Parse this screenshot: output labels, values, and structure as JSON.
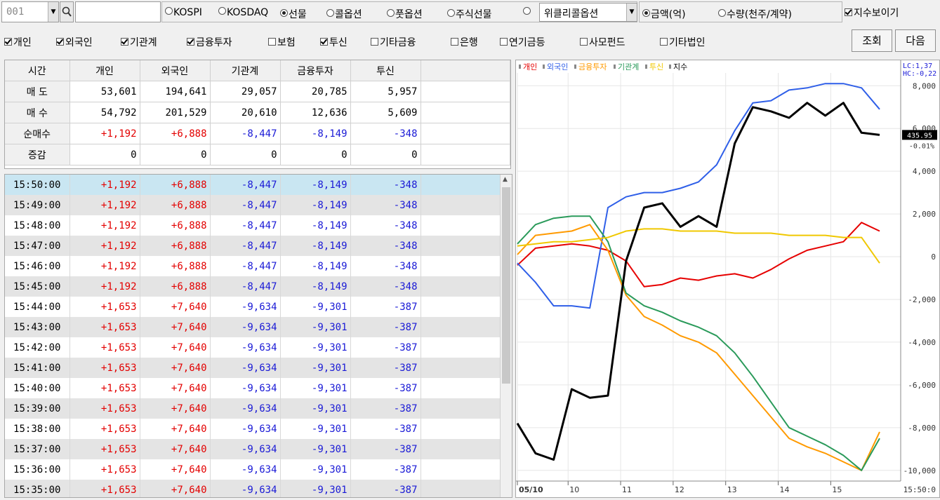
{
  "toolbar": {
    "code_value": "001",
    "market_options": [
      {
        "label": "KOSPI",
        "checked": false
      },
      {
        "label": "KOSDAQ",
        "checked": false
      },
      {
        "label": "선물",
        "checked": true
      },
      {
        "label": "콜옵션",
        "checked": false
      },
      {
        "label": "풋옵션",
        "checked": false
      },
      {
        "label": "주식선물",
        "checked": false
      },
      {
        "label": "",
        "checked": false
      }
    ],
    "weekly_select": "위클리콜옵션",
    "unit_options": [
      {
        "label": "금액(억)",
        "checked": true
      },
      {
        "label": "수량(천주/계약)",
        "checked": false
      }
    ],
    "show_index_label": "지수보이기",
    "show_index_checked": true
  },
  "investor_filters": [
    {
      "label": "개인",
      "checked": true
    },
    {
      "label": "외국인",
      "checked": true
    },
    {
      "label": "기관계",
      "checked": true
    },
    {
      "label": "금융투자",
      "checked": true
    },
    {
      "label": "보험",
      "checked": false
    },
    {
      "label": "투신",
      "checked": true
    },
    {
      "label": "기타금융",
      "checked": false
    },
    {
      "label": "은행",
      "checked": false
    },
    {
      "label": "연기금등",
      "checked": false
    },
    {
      "label": "사모펀드",
      "checked": false
    },
    {
      "label": "기타법인",
      "checked": false
    }
  ],
  "buttons": {
    "query": "조회",
    "next": "다음"
  },
  "summary": {
    "headers": [
      "시간",
      "개인",
      "외국인",
      "기관계",
      "금융투자",
      "투신"
    ],
    "rows": [
      {
        "label": "매  도",
        "values": [
          "53,601",
          "194,641",
          "29,057",
          "20,785",
          "5,957"
        ]
      },
      {
        "label": "매  수",
        "values": [
          "54,792",
          "201,529",
          "20,610",
          "12,636",
          "5,609"
        ]
      },
      {
        "label": "순매수",
        "values": [
          "+1,192",
          "+6,888",
          "-8,447",
          "-8,149",
          "-348"
        ]
      },
      {
        "label": "증감",
        "values": [
          "0",
          "0",
          "0",
          "0",
          "0"
        ]
      }
    ]
  },
  "timeline": [
    {
      "time": "15:50:00",
      "values": [
        "+1,192",
        "+6,888",
        "-8,447",
        "-8,149",
        "-348"
      ]
    },
    {
      "time": "15:49:00",
      "values": [
        "+1,192",
        "+6,888",
        "-8,447",
        "-8,149",
        "-348"
      ]
    },
    {
      "time": "15:48:00",
      "values": [
        "+1,192",
        "+6,888",
        "-8,447",
        "-8,149",
        "-348"
      ]
    },
    {
      "time": "15:47:00",
      "values": [
        "+1,192",
        "+6,888",
        "-8,447",
        "-8,149",
        "-348"
      ]
    },
    {
      "time": "15:46:00",
      "values": [
        "+1,192",
        "+6,888",
        "-8,447",
        "-8,149",
        "-348"
      ]
    },
    {
      "time": "15:45:00",
      "values": [
        "+1,192",
        "+6,888",
        "-8,447",
        "-8,149",
        "-348"
      ]
    },
    {
      "time": "15:44:00",
      "values": [
        "+1,653",
        "+7,640",
        "-9,634",
        "-9,301",
        "-387"
      ]
    },
    {
      "time": "15:43:00",
      "values": [
        "+1,653",
        "+7,640",
        "-9,634",
        "-9,301",
        "-387"
      ]
    },
    {
      "time": "15:42:00",
      "values": [
        "+1,653",
        "+7,640",
        "-9,634",
        "-9,301",
        "-387"
      ]
    },
    {
      "time": "15:41:00",
      "values": [
        "+1,653",
        "+7,640",
        "-9,634",
        "-9,301",
        "-387"
      ]
    },
    {
      "time": "15:40:00",
      "values": [
        "+1,653",
        "+7,640",
        "-9,634",
        "-9,301",
        "-387"
      ]
    },
    {
      "time": "15:39:00",
      "values": [
        "+1,653",
        "+7,640",
        "-9,634",
        "-9,301",
        "-387"
      ]
    },
    {
      "time": "15:38:00",
      "values": [
        "+1,653",
        "+7,640",
        "-9,634",
        "-9,301",
        "-387"
      ]
    },
    {
      "time": "15:37:00",
      "values": [
        "+1,653",
        "+7,640",
        "-9,634",
        "-9,301",
        "-387"
      ]
    },
    {
      "time": "15:36:00",
      "values": [
        "+1,653",
        "+7,640",
        "-9,634",
        "-9,301",
        "-387"
      ]
    },
    {
      "time": "15:35:00",
      "values": [
        "+1,653",
        "+7,640",
        "-9,634",
        "-9,301",
        "-387"
      ]
    }
  ],
  "chart_data": {
    "type": "line",
    "legend": [
      "개인",
      "외국인",
      "금융투자",
      "기관계",
      "투신",
      "지수"
    ],
    "legend_position": "top-left",
    "grid": true,
    "x_ticks": [
      "05/10",
      "10",
      "11",
      "12",
      "13",
      "14",
      "15",
      "15:50:0"
    ],
    "y_ticks": [
      "8,000",
      "6,000",
      "4,000",
      "2,000",
      "0",
      "-2,000",
      "-4,000",
      "-6,000",
      "-8,000",
      "-10,000"
    ],
    "ylim": [
      -10500,
      8600
    ],
    "top_labels": [
      "LC:1,37",
      "HC:-0,22"
    ],
    "index_last_label": "435.95",
    "index_sub_label": "-0.01%",
    "colors": {
      "개인": "#e60000",
      "외국인": "#2f5fe8",
      "금융투자": "#ff9a00",
      "기관계": "#2a9a5a",
      "투신": "#f0c800",
      "지수": "#000000"
    },
    "x": [
      0,
      0.05,
      0.1,
      0.15,
      0.2,
      0.25,
      0.3,
      0.35,
      0.4,
      0.45,
      0.5,
      0.55,
      0.6,
      0.65,
      0.7,
      0.75,
      0.8,
      0.85,
      0.9,
      0.95,
      1
    ],
    "series": [
      {
        "name": "개인",
        "values": [
          -400,
          400,
          500,
          600,
          500,
          300,
          -200,
          -1400,
          -1300,
          -1000,
          -1100,
          -900,
          -800,
          -1000,
          -600,
          -100,
          300,
          500,
          700,
          1600,
          1200
        ]
      },
      {
        "name": "외국인",
        "values": [
          -300,
          -1200,
          -2300,
          -2300,
          -2400,
          2300,
          2800,
          3000,
          3000,
          3200,
          3500,
          4300,
          5900,
          7200,
          7300,
          7800,
          7900,
          8100,
          8100,
          7900,
          6900
        ]
      },
      {
        "name": "금융투자",
        "values": [
          100,
          1000,
          1100,
          1200,
          1500,
          300,
          -1800,
          -2800,
          -3200,
          -3700,
          -4000,
          -4500,
          -5500,
          -6500,
          -7500,
          -8500,
          -8900,
          -9200,
          -9600,
          -10000,
          -8200
        ]
      },
      {
        "name": "기관계",
        "values": [
          600,
          1500,
          1800,
          1900,
          1900,
          700,
          -1700,
          -2300,
          -2600,
          -3000,
          -3300,
          -3700,
          -4500,
          -5600,
          -6800,
          -8000,
          -8400,
          -8800,
          -9300,
          -10000,
          -8500
        ]
      },
      {
        "name": "투신",
        "values": [
          500,
          600,
          700,
          700,
          800,
          900,
          1200,
          1300,
          1300,
          1200,
          1200,
          1200,
          1100,
          1100,
          1100,
          1000,
          1000,
          1000,
          900,
          900,
          -300
        ]
      },
      {
        "name": "지수",
        "values": [
          -7800,
          -9200,
          -9500,
          -6200,
          -6600,
          -6500,
          -200,
          2300,
          2500,
          1400,
          1900,
          1400,
          5300,
          7000,
          6800,
          6500,
          7200,
          6600,
          7200,
          5800,
          5700
        ]
      }
    ]
  }
}
